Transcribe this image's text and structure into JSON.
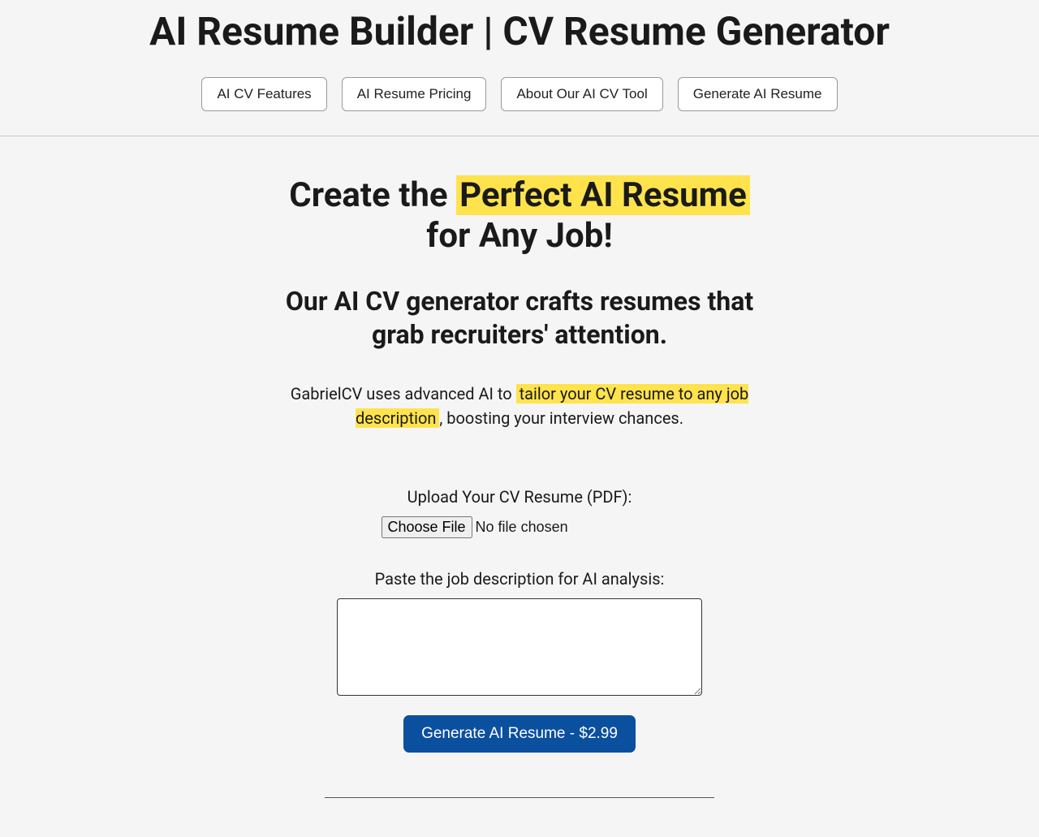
{
  "header": {
    "title": "AI Resume Builder | CV Resume Generator",
    "nav": [
      "AI CV Features",
      "AI Resume Pricing",
      "About Our AI CV Tool",
      "Generate AI Resume"
    ]
  },
  "hero": {
    "pre": "Create the ",
    "highlight": "Perfect AI Resume",
    "post": " for Any Job!"
  },
  "subheading": "Our AI CV generator crafts resumes that grab recruiters' attention.",
  "description": {
    "pre": "GabrielCV uses advanced AI to ",
    "highlight": "tailor your CV resume to any job description",
    "post": ", boosting your interview chances."
  },
  "form": {
    "upload_label": "Upload Your CV Resume (PDF):",
    "file_button": "Choose File",
    "file_status": "No file chosen",
    "jd_label": "Paste the job description for AI analysis:",
    "submit": "Generate AI Resume - $2.99"
  }
}
